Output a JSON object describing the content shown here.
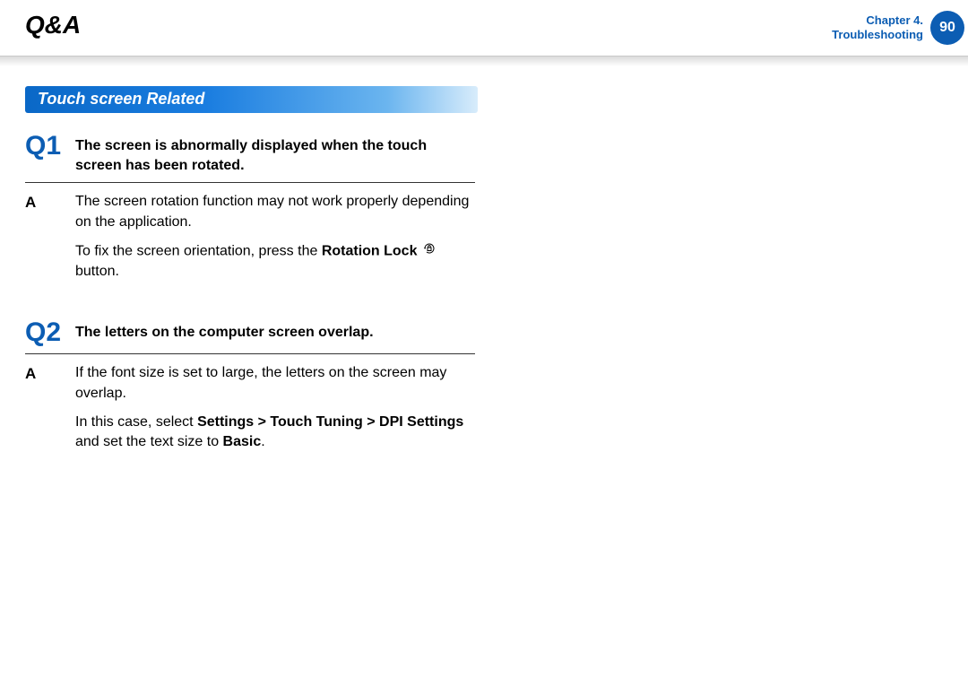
{
  "header": {
    "title": "Q&A",
    "chapter_line1": "Chapter 4.",
    "chapter_line2": "Troubleshooting",
    "page_number": "90"
  },
  "section": {
    "title": "Touch screen Related"
  },
  "qa": [
    {
      "q_label": "Q1",
      "q_text": "The screen is abnormally displayed when the touch screen has been rotated.",
      "a_label": "A",
      "a_text1": "The screen rotation function may not work properly depending on the application.",
      "a_fix_prefix": "To fix the screen orientation, press the ",
      "a_fix_bold": "Rotation Lock",
      "a_fix_suffix": " button."
    },
    {
      "q_label": "Q2",
      "q_text": "The letters on the computer screen overlap.",
      "a_label": "A",
      "a_text1": "If the font size is set to large, the letters on the screen may overlap.",
      "a_case_prefix": "In this case, select ",
      "a_case_bold_path": "Settings > Touch Tuning > DPI Settings",
      "a_case_middle": " and set the text size to ",
      "a_case_bold_end": "Basic",
      "a_case_suffix": "."
    }
  ]
}
